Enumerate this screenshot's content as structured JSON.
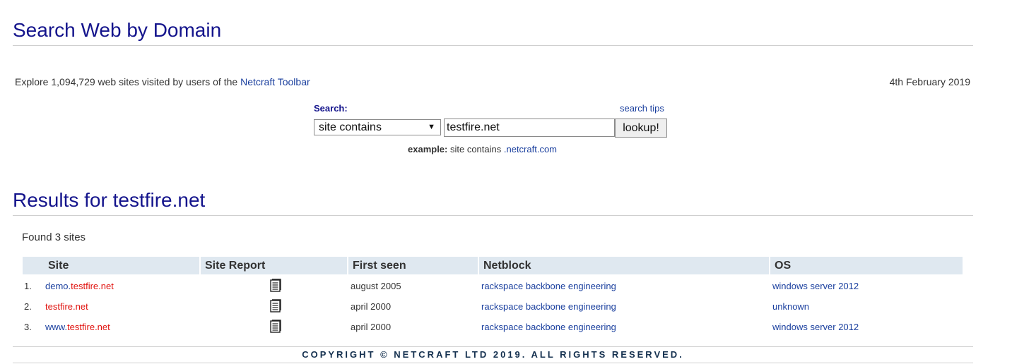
{
  "page": {
    "title": "Search Web by Domain",
    "explore_prefix": "Explore 1,094,729 web sites visited by users of the ",
    "explore_link": "Netcraft Toolbar",
    "date": "4th February 2019"
  },
  "search": {
    "label": "Search:",
    "tips_link": "search tips",
    "mode_selected": "site contains",
    "query_value": "testfire.net",
    "button_label": "lookup!",
    "example_label": "example:",
    "example_text": " site contains ",
    "example_link": ".netcraft.com"
  },
  "results": {
    "title": "Results for testfire.net",
    "found_text": "Found 3 sites",
    "columns": {
      "site": "Site",
      "site_report": "Site Report",
      "first_seen": "First seen",
      "netblock": "Netblock",
      "os": "OS"
    },
    "rows": [
      {
        "num": "1.",
        "site_prefix": "demo.",
        "site_domain": "testfire.net",
        "first_seen": "august 2005",
        "netblock": "rackspace backbone engineering",
        "os": "windows server 2012"
      },
      {
        "num": "2.",
        "site_prefix": "",
        "site_domain": "testfire.net",
        "first_seen": "april 2000",
        "netblock": "rackspace backbone engineering",
        "os": "unknown"
      },
      {
        "num": "3.",
        "site_prefix": "www.",
        "site_domain": "testfire.net",
        "first_seen": "april 2000",
        "netblock": "rackspace backbone engineering",
        "os": "windows server 2012"
      }
    ]
  },
  "footer": {
    "copyright": "COPYRIGHT © NETCRAFT LTD 2019. ALL RIGHTS RESERVED."
  },
  "icons": {
    "site_report": "document-icon",
    "select_arrow": "caret-down-icon"
  },
  "colors": {
    "heading": "#14148c",
    "link": "#1a3f9e",
    "highlight": "#e0120e",
    "table_header_bg": "#dfe8f0"
  }
}
